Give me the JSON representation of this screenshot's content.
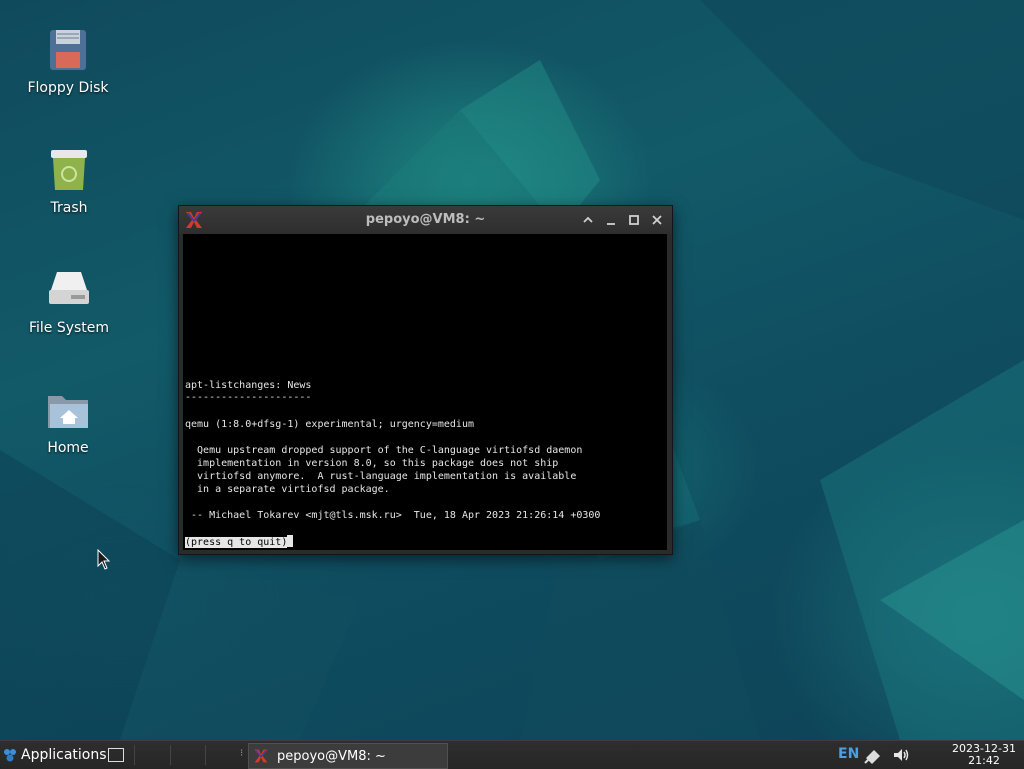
{
  "desktop": {
    "icons": [
      {
        "label": "Floppy Disk",
        "icon": "floppy-disk-icon"
      },
      {
        "label": "Trash",
        "icon": "trash-icon"
      },
      {
        "label": "File System",
        "icon": "hard-drive-icon"
      },
      {
        "label": "Home",
        "icon": "home-folder-icon"
      }
    ]
  },
  "window": {
    "title": "pepoyo@VM8: ~",
    "controls": [
      "shade-icon",
      "minimize-icon",
      "maximize-icon",
      "close-icon"
    ]
  },
  "terminal": {
    "lines": [
      "apt-listchanges: News",
      "---------------------",
      "qemu (1:8.0+dfsg-1) experimental; urgency=medium",
      "  Qemu upstream dropped support of the C-language virtiofsd daemon",
      "  implementation in version 8.0, so this package does not ship",
      "  virtiofsd anymore.  A rust-language implementation is available",
      "  in a separate virtiofsd package.",
      " -- Michael Tokarev <mjt@tls.msk.ru>  Tue, 18 Apr 2023 21:26:14 +0300"
    ],
    "prompt": "(press q to quit)"
  },
  "taskbar": {
    "applications_label": "Applications",
    "task_title": "pepoyo@VM8: ~",
    "language": "EN",
    "clock_date": "2023-12-31",
    "clock_time": "21:42"
  },
  "colors": {
    "accent_lang": "#4aa0e0",
    "terminal_bg": "#000000",
    "terminal_fg": "#e6e6e6"
  }
}
